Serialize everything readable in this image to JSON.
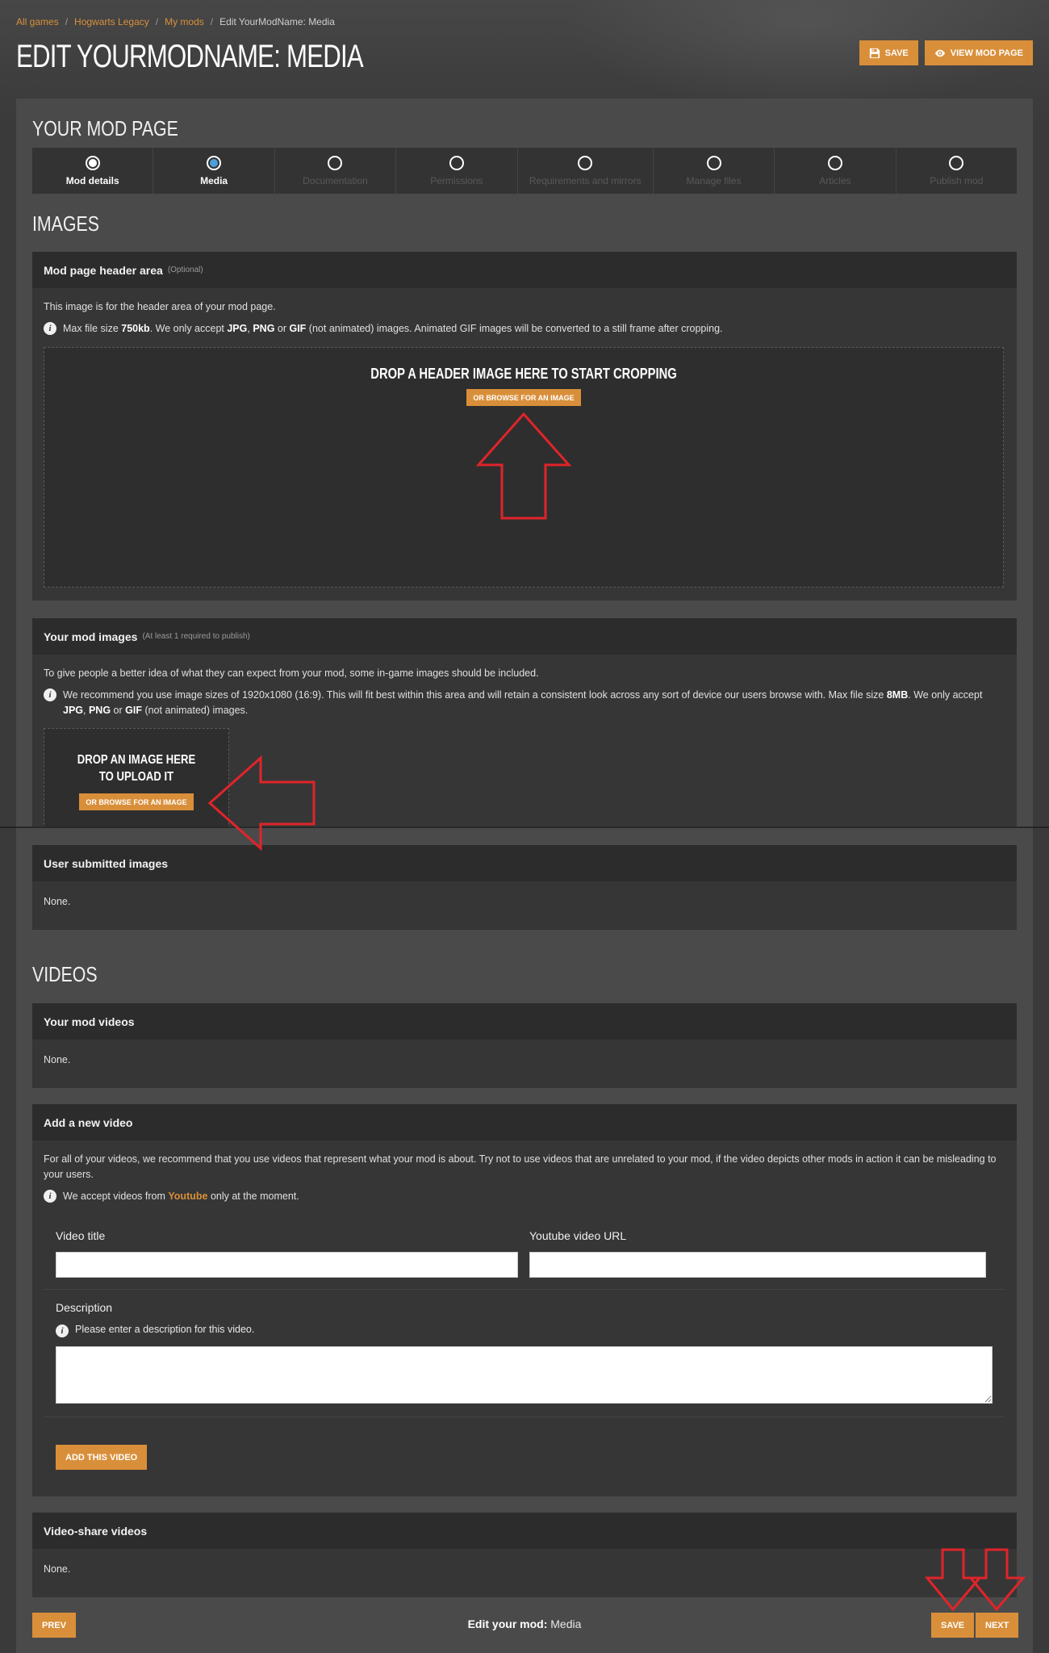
{
  "breadcrumb": {
    "items": [
      "All games",
      "Hogwarts Legacy",
      "My mods",
      "Edit YourModName: Media"
    ]
  },
  "header": {
    "title": "EDIT YOURMODNAME: MEDIA",
    "save_label": "SAVE",
    "view_label": "VIEW MOD PAGE"
  },
  "mod_page": {
    "title": "YOUR MOD PAGE",
    "steps": [
      {
        "label": "Mod details",
        "state": "done"
      },
      {
        "label": "Media",
        "state": "current"
      },
      {
        "label": "Documentation",
        "state": "inactive"
      },
      {
        "label": "Permissions",
        "state": "inactive"
      },
      {
        "label": "Requirements and mirrors",
        "state": "inactive"
      },
      {
        "label": "Manage files",
        "state": "inactive"
      },
      {
        "label": "Articles",
        "state": "inactive"
      },
      {
        "label": "Publish mod",
        "state": "inactive"
      }
    ]
  },
  "images": {
    "title": "IMAGES",
    "header_area": {
      "title": "Mod page header area",
      "optional": "(Optional)",
      "desc": "This image is for the header area of your mod page.",
      "info_a": "Max file size ",
      "info_size": "750kb",
      "info_b": ". We only accept ",
      "info_jpg": "JPG",
      "info_comma": ", ",
      "info_png": "PNG",
      "info_or": " or ",
      "info_gif": "GIF",
      "info_c": " (not animated) images. Animated GIF images will be converted to a still frame after cropping.",
      "drop_title": "DROP A HEADER IMAGE HERE TO START CROPPING",
      "browse_label": "OR BROWSE FOR AN IMAGE"
    },
    "mod_images": {
      "title": "Your mod images",
      "required": "(At least 1 required to publish)",
      "desc": "To give people a better idea of what they can expect from your mod, some in-game images should be included.",
      "info_a": "We recommend you use image sizes of 1920x1080 (16:9). This will fit best within this area and will retain a consistent look across any sort of device our users browse with. Max file size ",
      "info_size": "8MB",
      "info_b": ". We only accept ",
      "info_jpg": "JPG",
      "info_comma": ", ",
      "info_png": "PNG",
      "info_or": " or ",
      "info_gif": "GIF",
      "info_c": " (not animated) images.",
      "drop_title": "DROP AN IMAGE HERE TO UPLOAD IT",
      "browse_label": "OR BROWSE FOR AN IMAGE"
    },
    "user_submitted": {
      "title": "User submitted images",
      "value": "None."
    }
  },
  "videos": {
    "title": "VIDEOS",
    "mod_videos": {
      "title": "Your mod videos",
      "value": "None."
    },
    "add_video": {
      "title": "Add a new video",
      "desc": "For all of your videos, we recommend that you use videos that represent what your mod is about. Try not to use videos that are unrelated to your mod, if the video depicts other mods in action it can be misleading to your users.",
      "info_a": "We accept videos from ",
      "info_link": "Youtube",
      "info_b": " only at the moment.",
      "video_title_label": "Video title",
      "video_title_value": "",
      "url_label": "Youtube video URL",
      "url_value": "",
      "description_label": "Description",
      "description_hint": "Please enter a description for this video.",
      "description_value": "",
      "add_label": "ADD THIS VIDEO"
    },
    "share_videos": {
      "title": "Video-share videos",
      "value": "None."
    }
  },
  "footer": {
    "prev_label": "PREV",
    "center_bold": "Edit your mod:",
    "center_value": " Media",
    "save_label": "SAVE",
    "next_label": "NEXT"
  },
  "colors": {
    "accent": "#d98f3a",
    "step_current": "#4d9fd9",
    "annotation_arrow": "#e0242a"
  }
}
